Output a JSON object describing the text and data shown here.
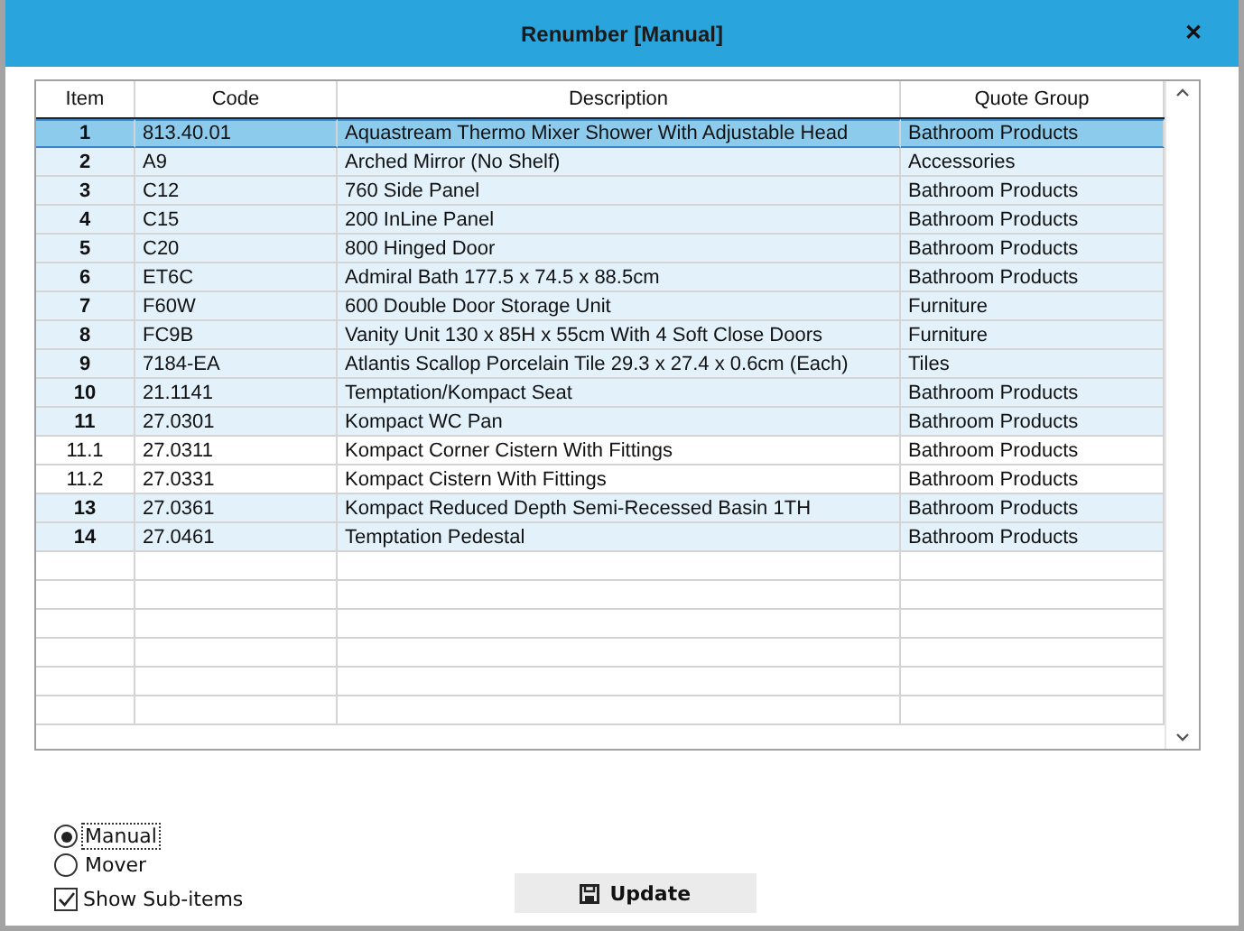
{
  "window": {
    "title": "Renumber [Manual]",
    "close": "✕"
  },
  "table": {
    "columns": [
      "Item",
      "Code",
      "Description",
      "Quote Group"
    ],
    "rows": [
      {
        "kind": "main",
        "selected": true,
        "cells": [
          "1",
          "813.40.01",
          "Aquastream Thermo Mixer Shower With Adjustable Head",
          "Bathroom Products"
        ]
      },
      {
        "kind": "main",
        "selected": false,
        "cells": [
          "2",
          "A9",
          "Arched Mirror (No Shelf)",
          "Accessories"
        ]
      },
      {
        "kind": "main",
        "selected": false,
        "cells": [
          "3",
          "C12",
          "760 Side Panel",
          "Bathroom Products"
        ]
      },
      {
        "kind": "main",
        "selected": false,
        "cells": [
          "4",
          "C15",
          "200 InLine Panel",
          "Bathroom Products"
        ]
      },
      {
        "kind": "main",
        "selected": false,
        "cells": [
          "5",
          "C20",
          "800 Hinged Door",
          "Bathroom Products"
        ]
      },
      {
        "kind": "main",
        "selected": false,
        "cells": [
          "6",
          "ET6C",
          "Admiral Bath 177.5 x 74.5 x 88.5cm",
          "Bathroom Products"
        ]
      },
      {
        "kind": "main",
        "selected": false,
        "cells": [
          "7",
          "F60W",
          "600 Double Door Storage Unit",
          "Furniture"
        ]
      },
      {
        "kind": "main",
        "selected": false,
        "cells": [
          "8",
          "FC9B",
          "Vanity Unit 130 x 85H x 55cm With 4 Soft Close Doors",
          "Furniture"
        ]
      },
      {
        "kind": "main",
        "selected": false,
        "cells": [
          "9",
          "7184-EA",
          "Atlantis Scallop Porcelain Tile 29.3 x 27.4 x 0.6cm (Each)",
          "Tiles"
        ]
      },
      {
        "kind": "main",
        "selected": false,
        "cells": [
          "10",
          "21.1141",
          "Temptation/Kompact Seat",
          "Bathroom Products"
        ]
      },
      {
        "kind": "main",
        "selected": false,
        "cells": [
          "11",
          "27.0301",
          "Kompact WC Pan",
          "Bathroom Products"
        ]
      },
      {
        "kind": "sub",
        "selected": false,
        "cells": [
          "11.1",
          "27.0311",
          "Kompact Corner Cistern With Fittings",
          "Bathroom Products"
        ]
      },
      {
        "kind": "sub",
        "selected": false,
        "cells": [
          "11.2",
          "27.0331",
          "Kompact Cistern With Fittings",
          "Bathroom Products"
        ]
      },
      {
        "kind": "main",
        "selected": false,
        "cells": [
          "13",
          "27.0361",
          "Kompact Reduced Depth Semi-Recessed Basin 1TH",
          "Bathroom Products"
        ]
      },
      {
        "kind": "main",
        "selected": false,
        "cells": [
          "14",
          "27.0461",
          "Temptation Pedestal",
          "Bathroom Products"
        ]
      }
    ]
  },
  "modes": [
    {
      "label": "Manual",
      "selected": true
    },
    {
      "label": "Mover",
      "selected": false
    }
  ],
  "show_sub_items": {
    "label": "Show Sub-items",
    "checked": true
  },
  "update_button": {
    "label": "Update"
  }
}
